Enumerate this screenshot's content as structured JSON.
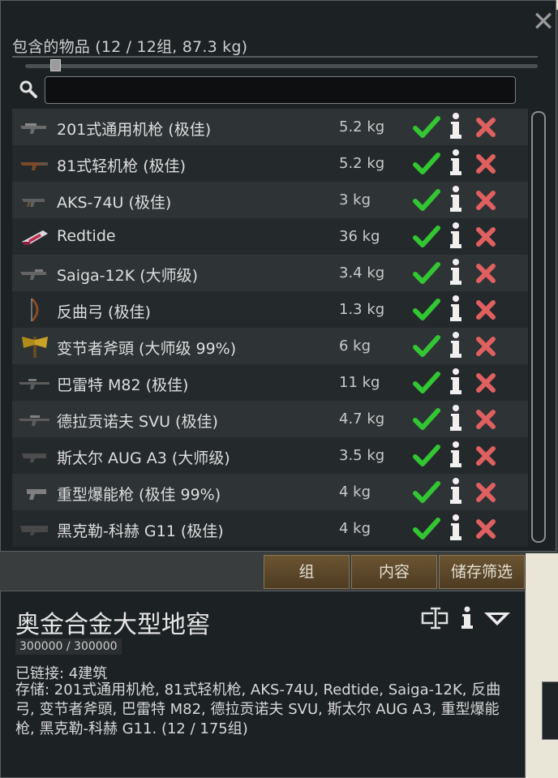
{
  "header": {
    "title": "包含的物品 (12 / 12组, 87.3 kg)",
    "close_icon": "close-icon",
    "search": {
      "value": "",
      "placeholder": ""
    },
    "filter_slider_value": 0.05
  },
  "items": [
    {
      "name": "201式通用机枪 (极佳)",
      "mass": "5.2 kg",
      "icon": "machine-gun-icon"
    },
    {
      "name": "81式轻机枪 (极佳)",
      "mass": "5.2 kg",
      "icon": "light-machine-gun-icon"
    },
    {
      "name": "AKS-74U (极佳)",
      "mass": "3 kg",
      "icon": "carbine-icon"
    },
    {
      "name": "Redtide",
      "mass": "36 kg",
      "icon": "heavy-weapon-icon"
    },
    {
      "name": "Saiga-12K (大师级)",
      "mass": "3.4 kg",
      "icon": "shotgun-icon"
    },
    {
      "name": "反曲弓 (极佳)",
      "mass": "1.3 kg",
      "icon": "bow-icon"
    },
    {
      "name": "变节者斧頭 (大师级 99%)",
      "mass": "6 kg",
      "icon": "axe-icon"
    },
    {
      "name": "巴雷特 M82 (极佳)",
      "mass": "11 kg",
      "icon": "sniper-rifle-icon"
    },
    {
      "name": "德拉贡诺夫 SVU (极佳)",
      "mass": "4.7 kg",
      "icon": "rifle-icon"
    },
    {
      "name": "斯太尔 AUG A3 (大师级)",
      "mass": "3.5 kg",
      "icon": "assault-rifle-icon"
    },
    {
      "name": "重型爆能枪 (极佳 99%)",
      "mass": "4 kg",
      "icon": "blaster-pistol-icon"
    },
    {
      "name": "黑克勒-科赫 G11 (极佳)",
      "mass": "4 kg",
      "icon": "caseless-rifle-icon"
    }
  ],
  "tabs": [
    {
      "label": "组"
    },
    {
      "label": "内容"
    },
    {
      "label": "储存筛选"
    }
  ],
  "building": {
    "title": "奥金合金大型地窖",
    "hp": "300000 / 300000",
    "linked": "已链接: 4建筑",
    "stored": "存储: 201式通用机枪, 81式轻机枪, AKS-74U, Redtide, Saiga-12K, 反曲弓, 变节者斧頭, 巴雷特 M82, 德拉贡诺夫 SVU, 斯太尔 AUG A3, 重型爆能枪, 黑克勒-科赫 G11. (12 / 175组)"
  },
  "colors": {
    "panel_bg": "#1c2124",
    "row_even": "#2e3336",
    "row_odd": "#24292c",
    "check_green": "#33c633",
    "delete_red": "#e06060",
    "tab_brown": "#5e4a2c"
  }
}
